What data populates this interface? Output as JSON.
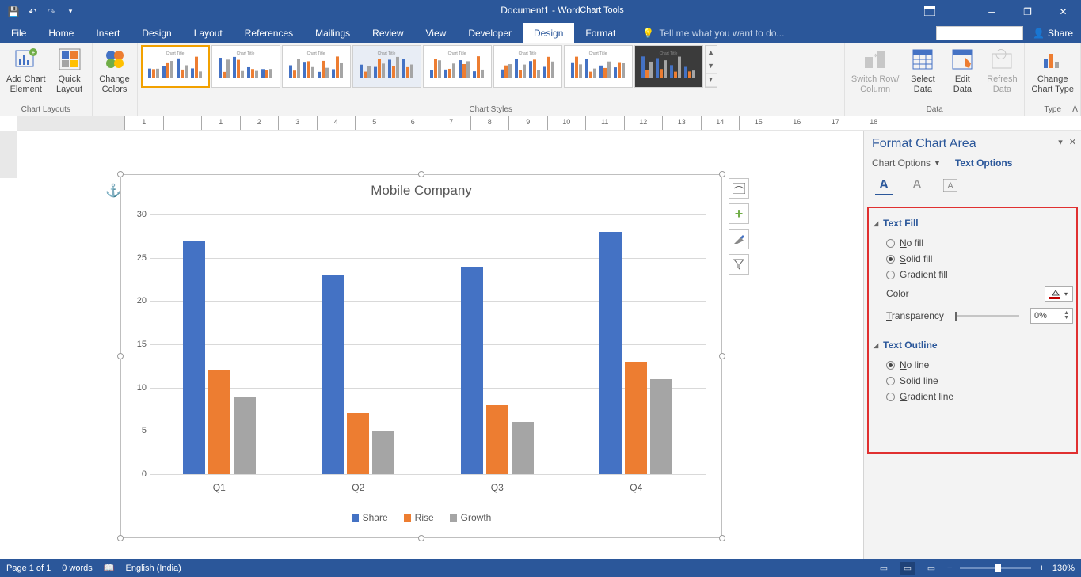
{
  "titlebar": {
    "doc_title": "Document1 - Word",
    "chart_tools": "Chart Tools"
  },
  "tabs": {
    "file": "File",
    "home": "Home",
    "insert": "Insert",
    "design": "Design",
    "layout": "Layout",
    "references": "References",
    "mailings": "Mailings",
    "review": "Review",
    "view": "View",
    "developer": "Developer",
    "ctx_design": "Design",
    "ctx_format": "Format",
    "tellme": "Tell me what you want to do...",
    "share": "Share"
  },
  "ribbon": {
    "add_chart_element": "Add Chart\nElement",
    "quick_layout": "Quick\nLayout",
    "change_colors": "Change\nColors",
    "switch_rc": "Switch Row/\nColumn",
    "select_data": "Select\nData",
    "edit_data": "Edit\nData",
    "refresh_data": "Refresh\nData",
    "change_chart_type": "Change\nChart Type",
    "grp_layouts": "Chart Layouts",
    "grp_styles": "Chart Styles",
    "grp_data": "Data",
    "grp_type": "Type"
  },
  "chart_data": {
    "type": "bar",
    "title": "Mobile Company",
    "categories": [
      "Q1",
      "Q2",
      "Q3",
      "Q4"
    ],
    "series": [
      {
        "name": "Share",
        "color": "#4472c4",
        "values": [
          27,
          23,
          24,
          28
        ]
      },
      {
        "name": "Rise",
        "color": "#ed7d31",
        "values": [
          12,
          7,
          8,
          13
        ]
      },
      {
        "name": "Growth",
        "color": "#a5a5a5",
        "values": [
          9,
          5,
          6,
          11
        ]
      }
    ],
    "ylim": [
      0,
      30
    ],
    "ystep": 5
  },
  "pane": {
    "title": "Format Chart Area",
    "chart_options": "Chart Options",
    "text_options": "Text Options",
    "text_fill": "Text Fill",
    "no_fill": "No fill",
    "solid_fill": "Solid fill",
    "gradient_fill": "Gradient fill",
    "color": "Color",
    "transparency": "Transparency",
    "transparency_val": "0%",
    "text_outline": "Text Outline",
    "no_line": "No line",
    "solid_line": "Solid line",
    "gradient_line": "Gradient line"
  },
  "status": {
    "page": "Page 1 of 1",
    "words": "0 words",
    "lang": "English (India)",
    "zoom": "130%"
  },
  "ruler_nums": [
    "1",
    "",
    "1",
    "2",
    "3",
    "4",
    "5",
    "6",
    "7",
    "8",
    "9",
    "10",
    "11",
    "12",
    "13",
    "14",
    "15",
    "16",
    "17",
    "18"
  ]
}
